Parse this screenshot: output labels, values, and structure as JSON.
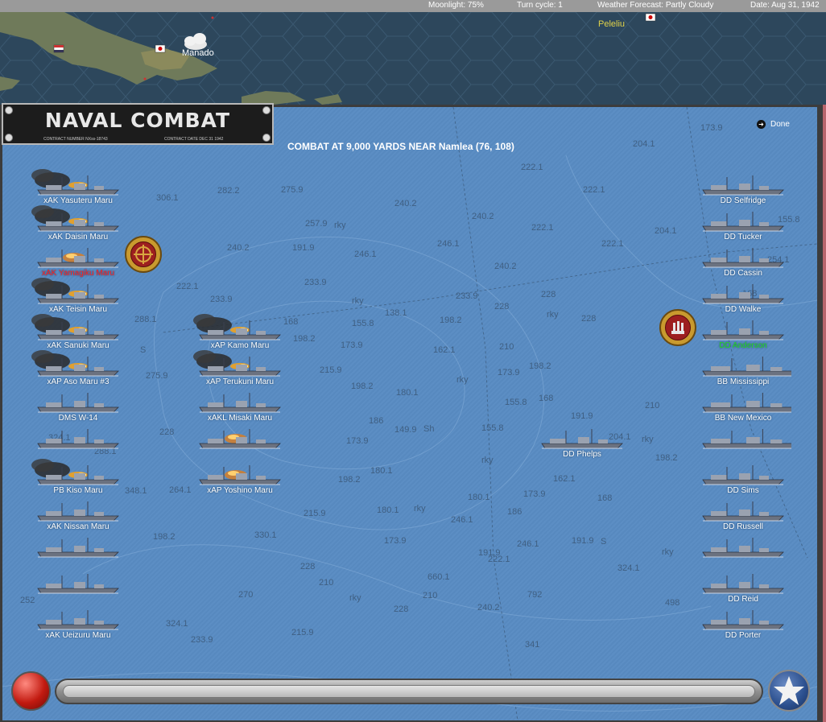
{
  "status_bar": {
    "moonlight": "Moonlight: 75%",
    "turn_cycle": "Turn cycle: 1",
    "weather": "Weather Forecast: Partly Cloudy",
    "date": "Date: Aug 31, 1942"
  },
  "map": {
    "places": [
      "Peleliu",
      "Manado"
    ]
  },
  "panel": {
    "title": "NAVAL COMBAT",
    "contract_number": "CONTRACT NUMBER  NXss-18743",
    "contract_date": "CONTRACT DATE  DEC 31 1942",
    "combat_text": "COMBAT AT 9,000 YARDS NEAR Namlea (76, 108)",
    "done_label": "Done"
  },
  "depths": [
    "173.9",
    "204.1",
    "222.1",
    "306.1",
    "282.2",
    "275.9",
    "240.2",
    "222.1",
    "240.2",
    "257.9",
    "rky",
    "246.1",
    "246.1",
    "222.1",
    "204.1",
    "155.8",
    "240.2",
    "191.9",
    "254.1",
    "240.2",
    "222.1",
    "233.9",
    "168",
    "222.1",
    "233.9",
    "228",
    "228",
    "233.9",
    "rky",
    "138.1",
    "198.2",
    "rky",
    "228",
    "288.1",
    "168",
    "155.8",
    "S",
    "198.2",
    "173.9",
    "162.1",
    "210",
    "198.2",
    "173.9",
    "275.9",
    "215.9",
    "rky",
    "198.2",
    "180.1",
    "155.8",
    "168",
    "210",
    "186",
    "149.9",
    "Sh",
    "155.8",
    "191.9",
    "204.1",
    "324.1",
    "228",
    "173.9",
    "rky",
    "rky",
    "198.2",
    "288.1",
    "180.1",
    "198.2",
    "rky",
    "348.1",
    "264.1",
    "215.9",
    "180.1",
    "180.1",
    "186",
    "162.1",
    "168",
    "173.9",
    "246.1",
    "330.1",
    "198.2",
    "173.9",
    "191.9",
    "S",
    "191.9",
    "222.1",
    "246.1",
    "rky",
    "228",
    "210",
    "660.1",
    "324.1",
    "252",
    "270",
    "rky",
    "228",
    "210",
    "240.2",
    "792",
    "498",
    "324.1",
    "233.9",
    "215.9",
    "341"
  ],
  "japanese_ships": [
    {
      "name": "xAK Yasuteru Maru",
      "color": "#ffffff"
    },
    {
      "name": "xAK Daisin Maru",
      "color": "#ffffff"
    },
    {
      "name": "xAK Yamagiku Maru",
      "color": "#ff2020"
    },
    {
      "name": "xAK Teisin Maru",
      "color": "#ffffff"
    },
    {
      "name": "xAK Sanuki Maru",
      "color": "#ffffff"
    },
    {
      "name": "xAP Aso Maru #3",
      "color": "#ffffff"
    },
    {
      "name": "DMS W-14",
      "color": "#ffffff"
    },
    {
      "name": "",
      "color": "#ffffff"
    },
    {
      "name": "PB Kiso Maru",
      "color": "#ffffff"
    },
    {
      "name": "xAK Nissan Maru",
      "color": "#ffffff"
    },
    {
      "name": "",
      "color": "#ffffff"
    },
    {
      "name": "",
      "color": "#ffffff"
    },
    {
      "name": "xAK Ueizuru Maru",
      "color": "#ffffff"
    },
    {
      "name": "xAP Kamo Maru",
      "color": "#ffffff"
    },
    {
      "name": "xAP Terukuni Maru",
      "color": "#ffffff"
    },
    {
      "name": "xAKL Misaki Maru",
      "color": "#ffffff"
    },
    {
      "name": "",
      "color": "#ffffff"
    },
    {
      "name": "xAP Yoshino Maru",
      "color": "#ffffff"
    }
  ],
  "allied_ships": [
    {
      "name": "DD Selfridge",
      "color": "#ffffff"
    },
    {
      "name": "DD Tucker",
      "color": "#ffffff"
    },
    {
      "name": "DD Cassin",
      "color": "#ffffff"
    },
    {
      "name": "DD Walke",
      "color": "#ffffff"
    },
    {
      "name": "DD Anderson",
      "color": "#22dd22"
    },
    {
      "name": "BB Mississippi",
      "color": "#ffffff"
    },
    {
      "name": "BB New Mexico",
      "color": "#ffffff"
    },
    {
      "name": "",
      "color": "#ffffff"
    },
    {
      "name": "DD Sims",
      "color": "#ffffff"
    },
    {
      "name": "DD Russell",
      "color": "#ffffff"
    },
    {
      "name": "",
      "color": "#ffffff"
    },
    {
      "name": "DD Reid",
      "color": "#ffffff"
    },
    {
      "name": "DD Porter",
      "color": "#ffffff"
    },
    {
      "name": "DD Phelps",
      "color": "#ffffff"
    }
  ],
  "icons": {
    "target_badge": "crosshair-icon",
    "fleet_badge": "warship-icon",
    "done": "arrow-right-icon",
    "record": "red-ball-icon",
    "star": "star-icon"
  }
}
